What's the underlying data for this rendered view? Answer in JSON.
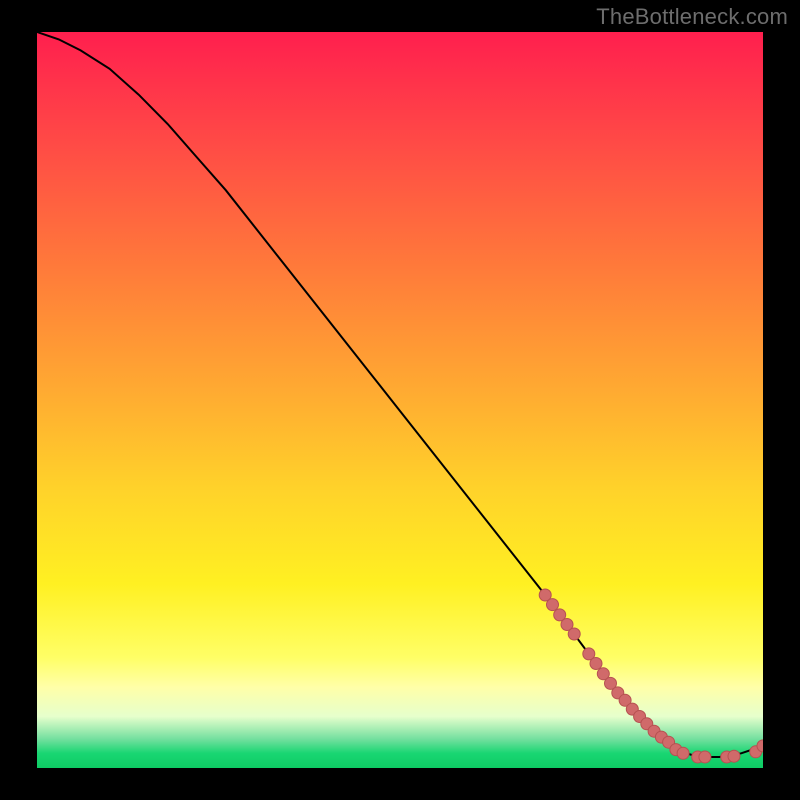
{
  "watermark": "TheBottleneck.com",
  "colors": {
    "line": "#000000",
    "marker_fill": "#d06a6a",
    "marker_stroke": "#b65151",
    "bg_black": "#000000",
    "gradient_top": "#ff1f4e",
    "gradient_bottom": "#0ecb64"
  },
  "chart_data": {
    "type": "line",
    "title": "",
    "xlabel": "",
    "ylabel": "",
    "xlim": [
      0,
      100
    ],
    "ylim": [
      0,
      100
    ],
    "legend": false,
    "grid": false,
    "series": [
      {
        "name": "bottleneck-curve",
        "x": [
          0,
          3,
          6,
          10,
          14,
          18,
          22,
          26,
          30,
          34,
          38,
          42,
          46,
          50,
          54,
          58,
          62,
          66,
          70,
          73,
          76,
          79,
          82,
          85,
          88,
          91,
          94,
          97,
          100
        ],
        "y": [
          100,
          99,
          97.5,
          95,
          91.5,
          87.5,
          83,
          78.5,
          73.5,
          68.5,
          63.5,
          58.5,
          53.5,
          48.5,
          43.5,
          38.5,
          33.5,
          28.5,
          23.5,
          19.5,
          15.5,
          11.5,
          8,
          5,
          2.5,
          1.5,
          1.5,
          2,
          3
        ]
      }
    ],
    "markers": {
      "name": "data-points",
      "x": [
        70,
        71,
        72,
        73,
        74,
        76,
        77,
        78,
        79,
        80,
        81,
        82,
        83,
        84,
        85,
        86,
        87,
        88,
        89,
        91,
        92,
        95,
        96,
        99,
        100
      ],
      "y": [
        23.5,
        22.2,
        20.8,
        19.5,
        18.2,
        15.5,
        14.2,
        12.8,
        11.5,
        10.2,
        9.2,
        8,
        7,
        6,
        5,
        4.2,
        3.5,
        2.5,
        2,
        1.5,
        1.5,
        1.5,
        1.6,
        2.2,
        3
      ]
    }
  }
}
